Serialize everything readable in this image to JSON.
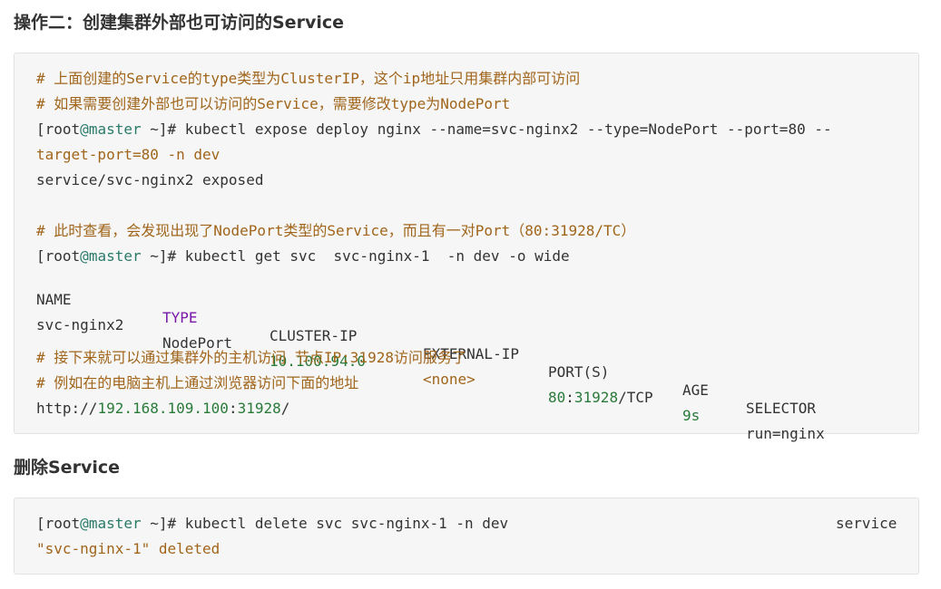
{
  "section1": {
    "title": "操作二：创建集群外部也可访问的Service",
    "comment1": "# 上面创建的Service的type类型为ClusterIP，这个ip地址只用集群内部可访问",
    "comment2": "# 如果需要创建外部也可以访问的Service，需要修改type为NodePort",
    "cmd1": {
      "prompt_open": "[root",
      "at": "@",
      "host": "master",
      "prompt_close": " ~]# kubectl expose deploy nginx --name=svc-nginx2 --type=NodePort --port=80 --",
      "continuation": "target-port=80 -n dev"
    },
    "output1": "service/svc-nginx2 exposed",
    "comment3": "# 此时查看，会发现出现了NodePort类型的Service，而且有一对Port（80:31928/TC）",
    "cmd2": {
      "prompt_open": "[root",
      "at": "@",
      "host": "master",
      "prompt_close": " ~]# kubectl get svc  svc-nginx-1  -n dev -o wide"
    },
    "table": {
      "headers": [
        "NAME",
        "TYPE",
        "CLUSTER-IP",
        "EXTERNAL-IP",
        "PORT(S)",
        "AGE",
        "SELECTOR"
      ],
      "row": {
        "name": "svc-nginx2",
        "type": "NodePort",
        "cluster_ip": "10.100.94.0",
        "external_ip": "<none>",
        "port_num": "80",
        "port_sep": ":",
        "port_node": "31928",
        "port_proto": "/TCP",
        "age": "9s",
        "selector": "run=nginx"
      }
    },
    "comment4": "# 接下来就可以通过集群外的主机访问 节点IP:31928访问服务了",
    "comment5": "# 例如在的电脑主机上通过浏览器访问下面的地址",
    "url": {
      "scheme": "http://",
      "ip": "192.168.109.100",
      "sep": ":",
      "port": "31928",
      "tail": "/"
    }
  },
  "section2": {
    "title": "删除Service",
    "cmd": {
      "prompt_open": "[root",
      "at": "@",
      "host": "master",
      "prompt_close": " ~]# kubectl delete svc svc-nginx-1 -n dev",
      "trail": "service"
    },
    "output": "\"svc-nginx-1\" deleted"
  },
  "colors": {
    "comment": "#a0651b",
    "host": "#2a7a69",
    "keyword": "#7a1aa8",
    "number": "#2a7a3a",
    "code_bg": "#f6f6f6"
  }
}
